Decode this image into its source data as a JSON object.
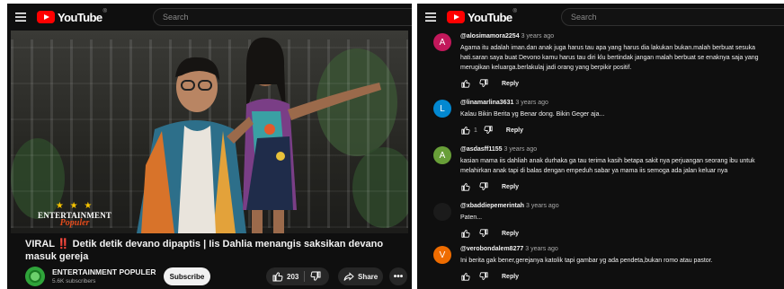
{
  "app": {
    "logo_text": "YouTube",
    "logo_mark": "®",
    "search_placeholder": "Search"
  },
  "video": {
    "watermark_line1": "ENTERTAINMENT",
    "watermark_line2": "Populer",
    "title_prefix": "VIRAL",
    "title_bang": "‼️",
    "title_rest": " Detik detik devano dipaptis | Iis Dahlia menangis saksikan devano masuk gereja"
  },
  "channel": {
    "name": "ENTERTAINMENT POPULER",
    "subscribers": "5.6K subscribers",
    "subscribe_label": "Subscribe",
    "like_count": "203",
    "share_label": "Share",
    "more_label": "•••"
  },
  "comments": [
    {
      "user": "@alosimamora2254",
      "time": "3 years ago",
      "initial": "A",
      "avatar_color": "#c2185b",
      "lines": [
        "Agama itu adalah iman.dan anak juga harus tau apa yang harus dia lakukan bukan.malah berbuat sesuka",
        "hati.saran saya buat Devono kamu harus tau diri klu bertindak jangan malah berbuat se enaknya saja yang",
        "merugikan keluarga.berlakulaj jadi orang yang berpikir positif."
      ],
      "likes": "",
      "reply_label": "Reply"
    },
    {
      "user": "@linamarlina3631",
      "time": "3 years ago",
      "initial": "L",
      "avatar_color": "#0288d1",
      "lines": [
        "Kalau Bikin Berita yg Benar dong. Bikin Geger aja..."
      ],
      "likes": "1",
      "reply_label": "Reply"
    },
    {
      "user": "@asdasff1155",
      "time": "3 years ago",
      "initial": "A",
      "avatar_color": "#689f38",
      "lines": [
        "kasian mama iis dahliah anak durhaka ga tau terima kasih betapa sakit nya perjuangan seorang ibu untuk",
        "melahirkan anak tapi di balas dengan empeduh sabar ya mama iis semoga ada jalan keluar nya"
      ],
      "likes": "",
      "reply_label": "Reply"
    },
    {
      "user": "@xbaddiepemerintah",
      "time": "3 years ago",
      "initial": "",
      "avatar_color": "#1b1b1b",
      "lines": [
        "Paten..."
      ],
      "likes": "",
      "reply_label": "Reply"
    },
    {
      "user": "@verobondalem8277",
      "time": "3 years ago",
      "initial": "V",
      "avatar_color": "#ef6c00",
      "lines": [
        "Ini berita gak bener,gerejanya katolik tapi gambar yg ada pendeta,bukan romo atau pastor."
      ],
      "likes": "",
      "reply_label": "Reply"
    }
  ],
  "icons": [
    "menu-icon",
    "youtube-logo-icon",
    "thumbs-up-icon",
    "thumbs-down-icon",
    "share-icon",
    "more-icon"
  ]
}
